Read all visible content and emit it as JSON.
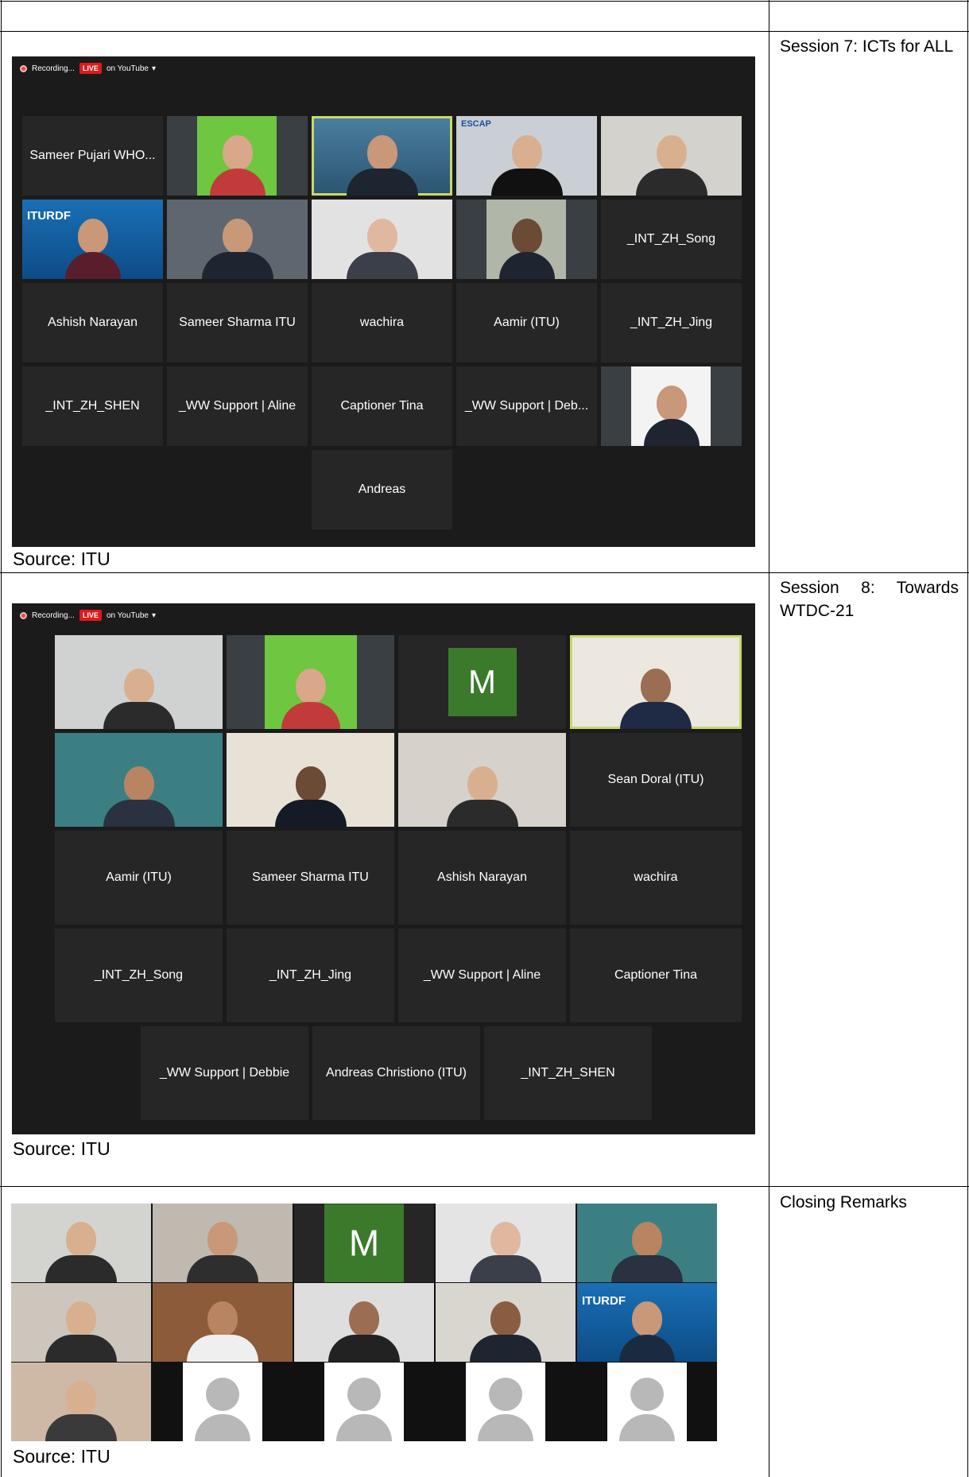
{
  "zoom_ui": {
    "recording": "Recording...",
    "live": "LIVE",
    "on_youtube": "on YouTube",
    "dropdown_icon": "caret-down-icon",
    "rec_icon": "record-icon"
  },
  "rows": [
    {
      "session": "Session 7: ICTs for ALL",
      "caption": "Source: ITU",
      "tiles": [
        "Sameer Pujari WHO...",
        "Ashish Narayan",
        "Sameer Sharma ITU",
        "wachira",
        "Aamir (ITU)",
        "_INT_ZH_Jing",
        "_INT_ZH_Song",
        "_INT_ZH_SHEN",
        "_WW Support | Aline",
        "Captioner Tina",
        "_WW Support | Deb...",
        "Andreas"
      ],
      "logo_texts": [
        "ESCAP",
        "ITURDF"
      ]
    },
    {
      "session": "Session 8: Towards WTDC-21",
      "caption": "Source: ITU",
      "tiles": [
        "Sean Doral (ITU)",
        "Aamir (ITU)",
        "Sameer Sharma ITU",
        "Ashish Narayan",
        "wachira",
        "_INT_ZH_Song",
        "_INT_ZH_Jing",
        "_WW Support | Aline",
        "Captioner Tina",
        "_WW Support | Debbie",
        "Andreas Christiono (ITU)",
        "_INT_ZH_SHEN"
      ],
      "initial": "M"
    },
    {
      "session": "Closing Remarks",
      "caption": "Source: ITU",
      "initial": "M",
      "logo_texts": [
        "ITURDF"
      ]
    }
  ]
}
